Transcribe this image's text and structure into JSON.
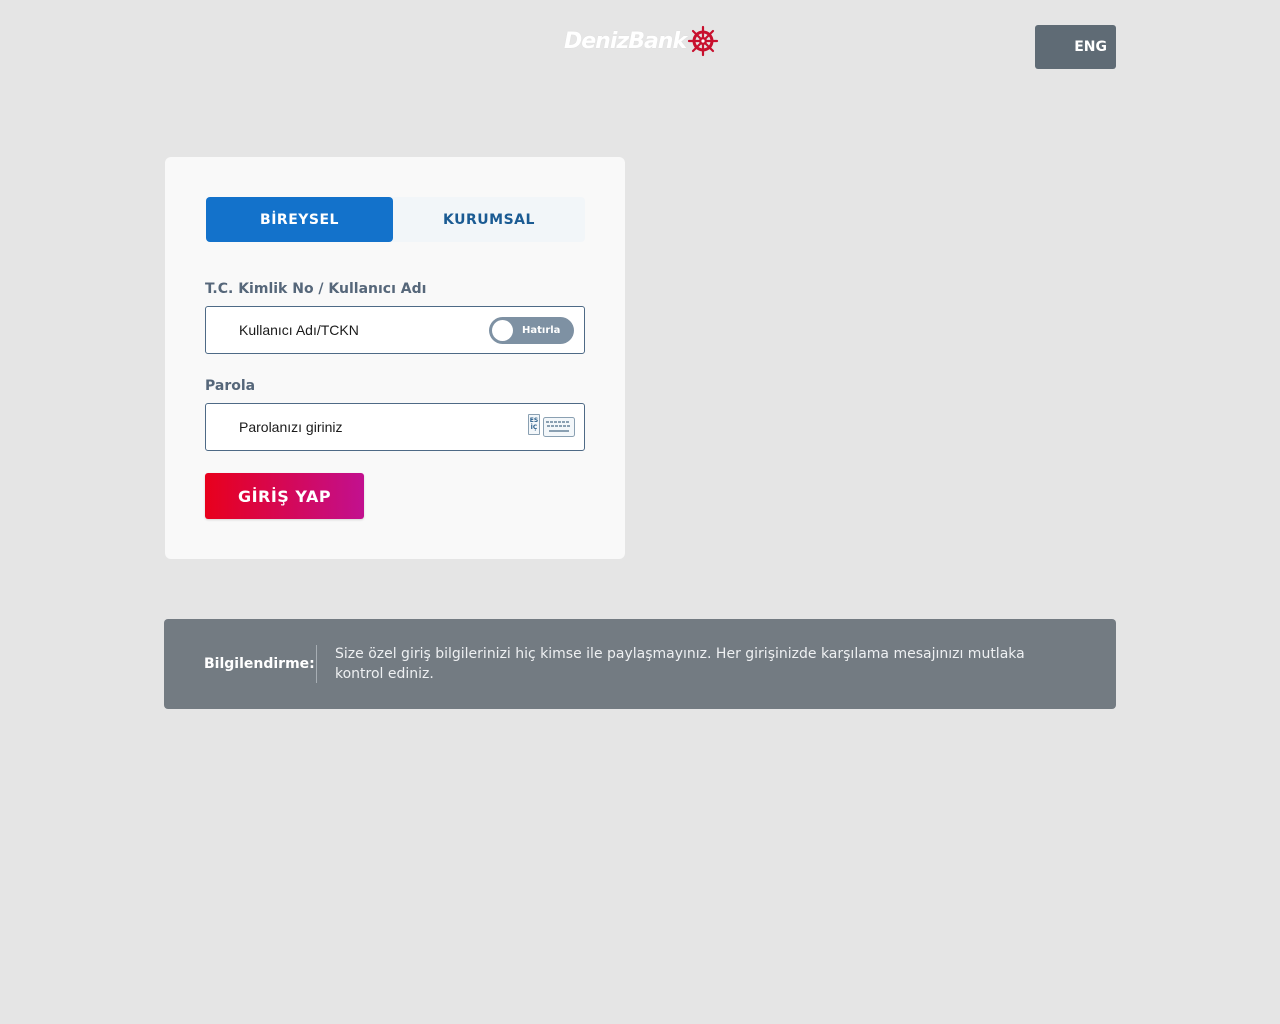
{
  "header": {
    "logo_text": "DenizBank",
    "logo_icon": "ship-wheel-icon",
    "language_button": "ENG"
  },
  "login": {
    "tabs": [
      {
        "label": "BİREYSEL",
        "active": true
      },
      {
        "label": "KURUMSAL",
        "active": false
      }
    ],
    "username": {
      "label": "T.C. Kimlik No / Kullanıcı Adı",
      "placeholder": "Kullanıcı Adı/TCKN",
      "value": "",
      "remember_label": "Hatırla",
      "remember_on": false
    },
    "password": {
      "label": "Parola",
      "placeholder": "Parolanızı giriniz",
      "value": "",
      "keyboard_lang_top": "ES",
      "keyboard_lang_bottom": "İÇ",
      "keyboard_icon": "virtual-keyboard-icon"
    },
    "submit_label": "GİRİŞ YAP"
  },
  "info": {
    "title": "Bilgilendirme:",
    "text": "Size özel giriş bilgilerinizi hiç kimse ile paylaşmayınız. Her girişinizde karşılama mesajınızı mutlaka kontrol ediniz."
  },
  "colors": {
    "background": "#e5e5e5",
    "tab_active": "#1372cb",
    "tab_inactive_text": "#1b5b93",
    "login_gradient_start": "#e8001c",
    "login_gradient_end": "#c2108f",
    "info_background": "#737b82",
    "language_button": "#5f6b75"
  }
}
